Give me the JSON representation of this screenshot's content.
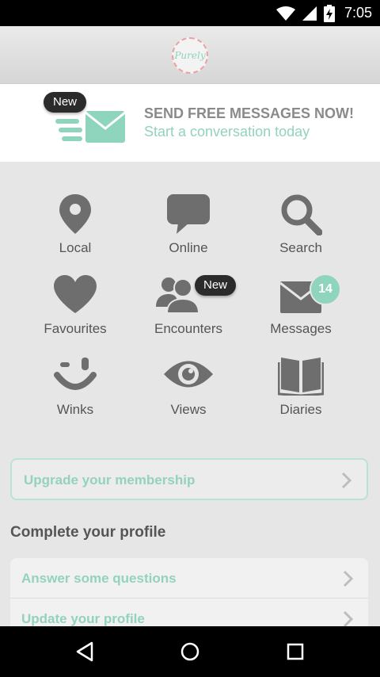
{
  "status_bar": {
    "time": "7:05",
    "icons": [
      "wifi-icon",
      "signal-icon",
      "battery-charging-icon"
    ]
  },
  "header": {
    "logo_text": "Purely"
  },
  "promo": {
    "badge": "New",
    "title": "SEND FREE MESSAGES NOW!",
    "subtitle": "Start a conversation today",
    "icon": "envelope-icon"
  },
  "grid": [
    {
      "label": "Local",
      "icon": "location-pin-icon"
    },
    {
      "label": "Online",
      "icon": "speech-bubble-icon"
    },
    {
      "label": "Search",
      "icon": "search-icon"
    },
    {
      "label": "Favourites",
      "icon": "heart-icon"
    },
    {
      "label": "Encounters",
      "icon": "people-icon",
      "badge": "New"
    },
    {
      "label": "Messages",
      "icon": "envelope-icon",
      "badge_count": "14"
    },
    {
      "label": "Winks",
      "icon": "wink-face-icon"
    },
    {
      "label": "Views",
      "icon": "eye-icon"
    },
    {
      "label": "Diaries",
      "icon": "book-icon"
    }
  ],
  "upgrade": {
    "label": "Upgrade your membership"
  },
  "profile": {
    "title": "Complete your profile",
    "items": [
      {
        "label": "Answer some questions"
      },
      {
        "label": "Update your profile"
      }
    ]
  },
  "colors": {
    "accent": "#8fd4bd",
    "icon_gray": "#6e6e6e",
    "background": "#e6e6e6",
    "badge_dark": "#2b2b2b"
  },
  "nav_bar": {
    "buttons": [
      "back-icon",
      "home-icon",
      "recents-icon"
    ]
  }
}
